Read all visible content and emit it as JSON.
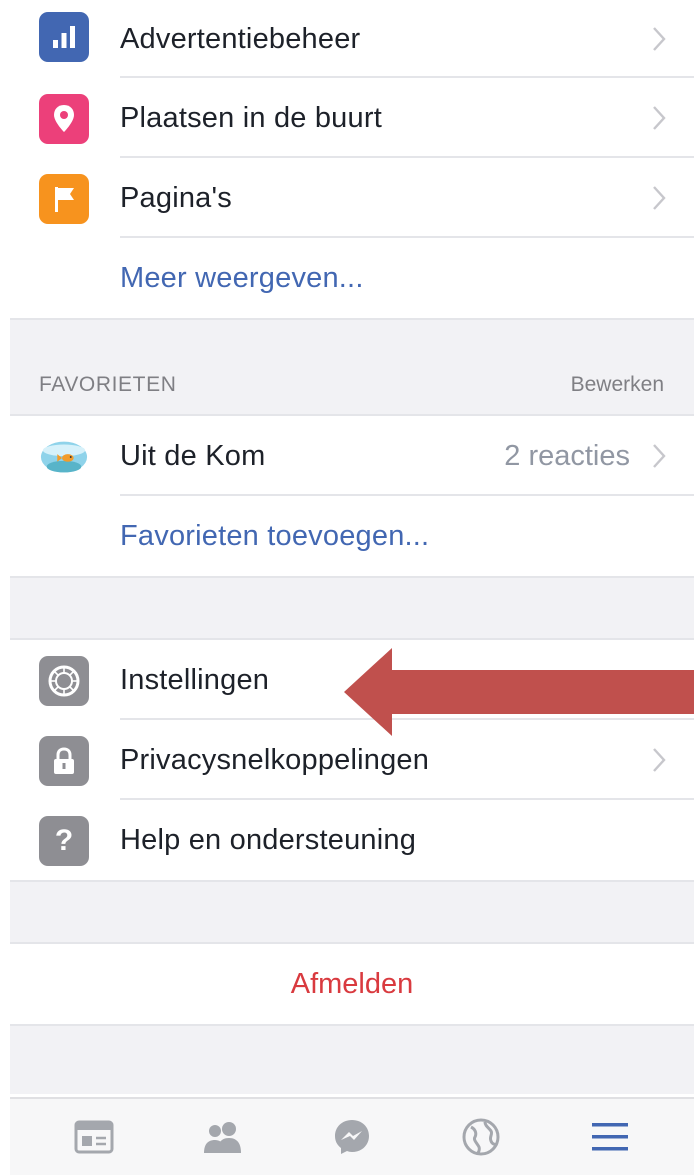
{
  "menu": {
    "items": [
      {
        "label": "Advertentiebeheer",
        "icon": "ads-manager-icon",
        "color": "#4267b2"
      },
      {
        "label": "Plaatsen in de buurt",
        "icon": "location-pin-icon",
        "color": "#ec407a"
      },
      {
        "label": "Pagina's",
        "icon": "flag-icon",
        "color": "#f7931e"
      }
    ],
    "more_link": "Meer weergeven..."
  },
  "favorites": {
    "header": "FAVORIETEN",
    "edit_label": "Bewerken",
    "items": [
      {
        "label": "Uit de Kom",
        "icon": "fishbowl-icon",
        "detail": "2 reacties"
      }
    ],
    "add_link": "Favorieten toevoegen..."
  },
  "settings": {
    "items": [
      {
        "label": "Instellingen",
        "icon": "gear-icon"
      },
      {
        "label": "Privacysnelkoppelingen",
        "icon": "lock-icon"
      },
      {
        "label": "Help en ondersteuning",
        "icon": "question-icon"
      }
    ]
  },
  "logout_label": "Afmelden",
  "tabbar": {
    "tabs": [
      {
        "icon": "news-feed-icon",
        "active": false
      },
      {
        "icon": "friends-icon",
        "active": false
      },
      {
        "icon": "messenger-icon",
        "active": false
      },
      {
        "icon": "globe-icon",
        "active": false
      },
      {
        "icon": "menu-icon",
        "active": true
      }
    ]
  },
  "colors": {
    "link": "#4267b2",
    "logout": "#d93a3f",
    "annotation_arrow": "#c0504d",
    "icon_gray": "#8e8e93"
  }
}
